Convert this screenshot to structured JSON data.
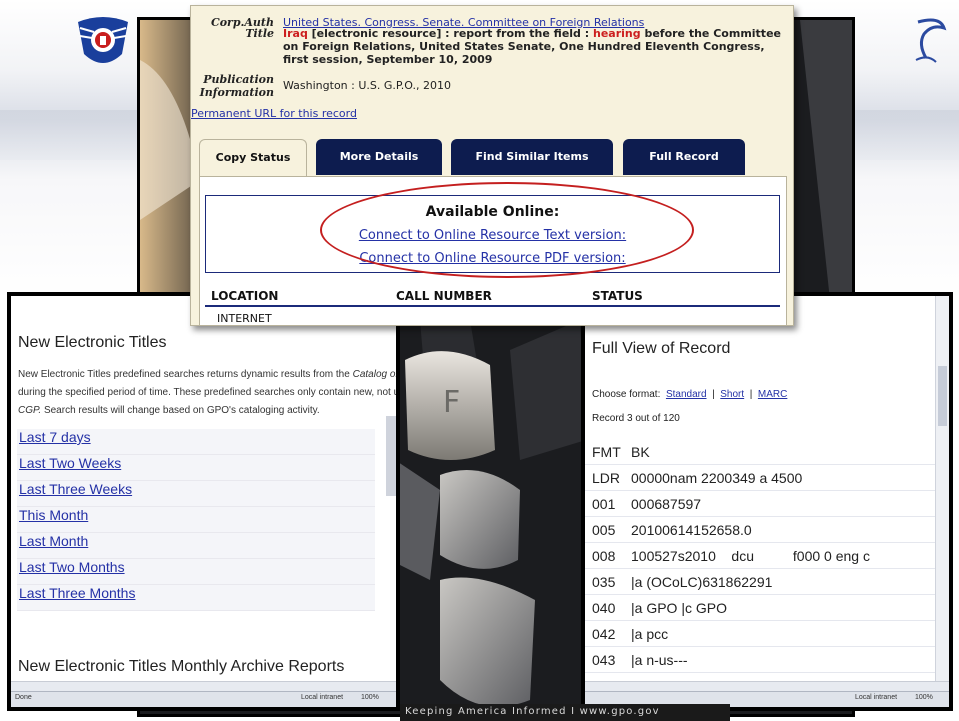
{
  "record": {
    "corp_auth_label": "Corp.Auth",
    "corp_auth_value": "United States. Congress. Senate. Committee on Foreign Relations",
    "title_label": "Title",
    "title_part1": "Iraq",
    "title_part2": " [electronic resource] : report from the field : ",
    "title_part3": "hearing",
    "title_part4": " before the Committee on Foreign Relations, United States Senate, One Hundred Eleventh Congress, first session, September 10, 2009",
    "pub_label_1": "Publication",
    "pub_label_2": "Information",
    "pub_value": "Washington : U.S. G.P.O., 2010",
    "permanent_url": "Permanent URL for this record",
    "tabs": [
      "Copy Status",
      "More Details",
      "Find Similar Items",
      "Full Record"
    ],
    "available_online": "Available Online:",
    "link_text": "Connect to Online Resource Text version:",
    "link_pdf": "Connect to Online Resource PDF version:",
    "col_location": "LOCATION",
    "col_callnumber": "CALL NUMBER",
    "col_status": "STATUS",
    "location_value": "INTERNET"
  },
  "left_panel": {
    "title": "New Electronic Titles",
    "desc_line1_a": "New Electronic Titles predefined searches returns dynamic results from the ",
    "desc_line1_b": "Catalog of U.S",
    "desc_line2": "during the specified period of time. These predefined searches only contain new, not updat",
    "desc_line3_a": "CGP.",
    "desc_line3_b": " Search results will change based on GPO's cataloging activity.",
    "items": [
      "Last 7 days",
      "Last Two Weeks",
      "Last Three Weeks",
      "This Month",
      "Last Month",
      "Last Two Months",
      "Last Three Months"
    ],
    "archive_title": "New Electronic Titles Monthly Archive Reports"
  },
  "right_panel": {
    "title": "Full View of Record",
    "choose_format": "Choose format:",
    "formats": [
      "Standard",
      "Short",
      "MARC"
    ],
    "separator": "|",
    "record_count": "Record 3 out of 120",
    "rows": [
      {
        "tag": "FMT",
        "value": "BK"
      },
      {
        "tag": "LDR",
        "value": "00000nam  2200349 a 4500"
      },
      {
        "tag": "001",
        "value": "000687597"
      },
      {
        "tag": "005",
        "value": "20100614152658.0"
      },
      {
        "tag": "008",
        "value": "100527s2010    dcu          f000 0 eng c"
      },
      {
        "tag": "035",
        "value": "|a (OCoLC)631862291"
      },
      {
        "tag": "040",
        "value": "|a GPO |c GPO"
      },
      {
        "tag": "042",
        "value": "|a pcc"
      },
      {
        "tag": "043",
        "value": "|a n-us---"
      }
    ]
  },
  "footer": {
    "text": "Keeping America Informed  I  www.gpo.gov"
  },
  "statusbar": {
    "left_done": "Done",
    "zone": "Local intranet",
    "zoom": "100%"
  }
}
